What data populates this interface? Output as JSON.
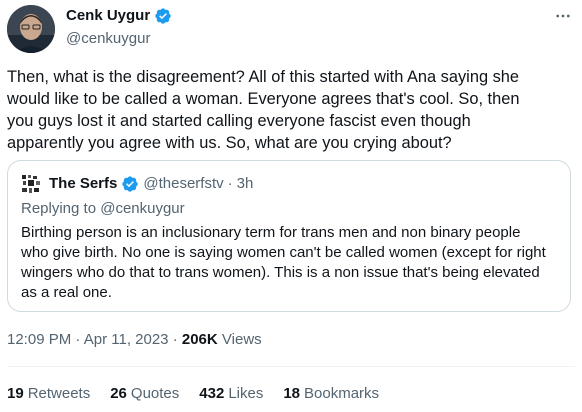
{
  "tweet": {
    "author": {
      "name": "Cenk Uygur",
      "handle": "@cenkuygur"
    },
    "text_lines": [
      "Then, what is the disagreement? All of this started with Ana saying she",
      "would like to be called a woman. Everyone agrees that's cool. So, then",
      "you guys lost it and started calling everyone fascist even though",
      "apparently you agree with us. So, what are you crying about?"
    ],
    "quoted": {
      "name": "The Serfs",
      "handle": "@theserfstv",
      "separator": "·",
      "time": "3h",
      "replying_to": "Replying to @cenkuygur",
      "text_lines": [
        "Birthing person is an inclusionary term for trans men and non binary people",
        "who give birth. No one is saying women can't be called women (except for right",
        "wingers who do that to trans women). This is a non issue that's being elevated",
        "as a real one."
      ]
    },
    "meta": {
      "time": "12:09 PM",
      "dot1": "·",
      "date": "Apr 11, 2023",
      "dot2": "·",
      "views_count": "206K",
      "views_label": "Views"
    },
    "stats": [
      {
        "count": "19",
        "label": "Retweets"
      },
      {
        "count": "26",
        "label": "Quotes"
      },
      {
        "count": "432",
        "label": "Likes"
      },
      {
        "count": "18",
        "label": "Bookmarks"
      }
    ]
  },
  "icons": {
    "verified": "verified-badge-icon",
    "more": "more-horizontal-icon"
  },
  "colors": {
    "verified_blue": "#1d9bf0",
    "secondary_text": "#536471",
    "primary_text": "#0f1419",
    "border": "#cfd9de"
  }
}
